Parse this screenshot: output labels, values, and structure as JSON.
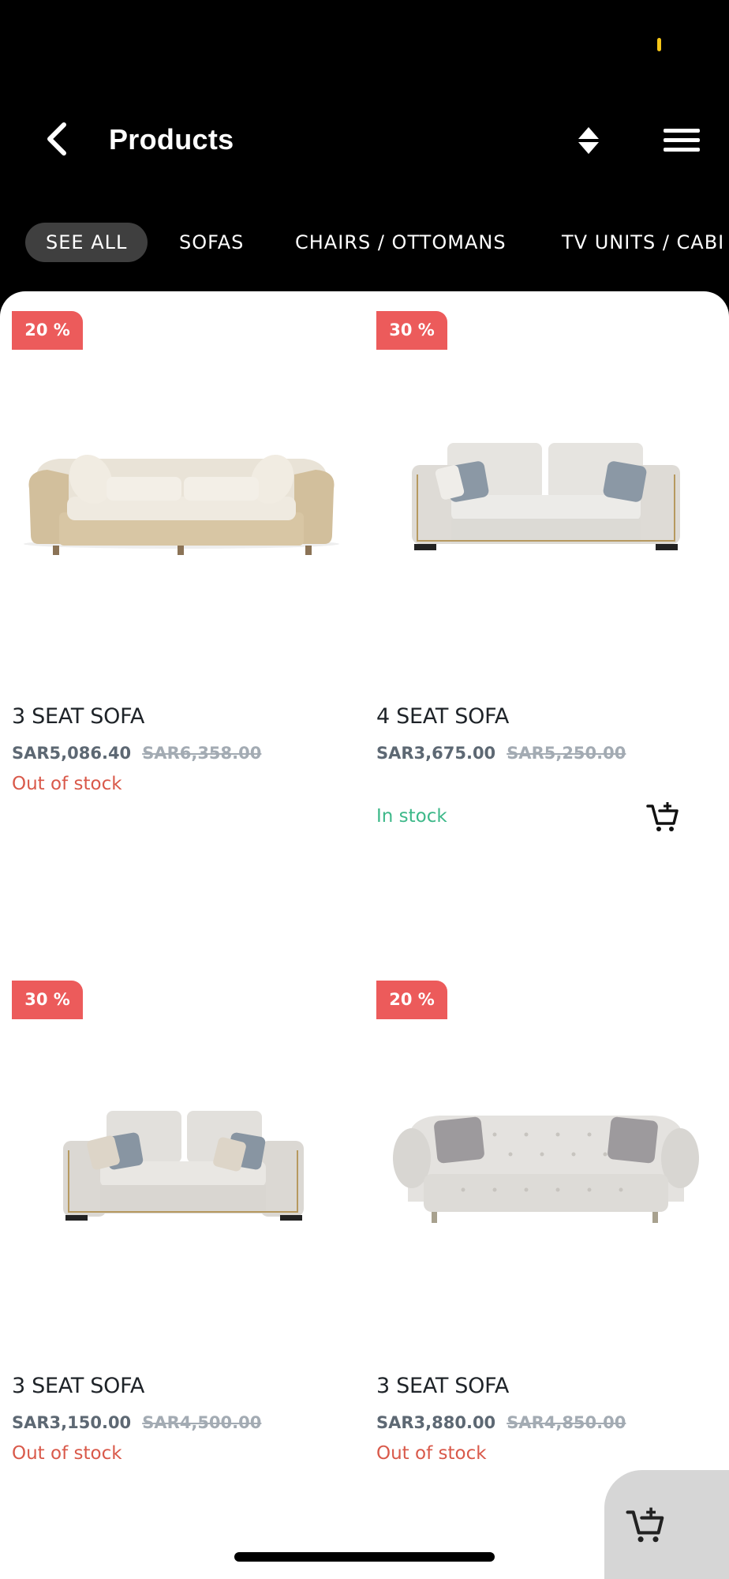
{
  "header": {
    "title": "Products",
    "back_icon": "chevron-left-icon",
    "sort_icon": "sort-icon",
    "menu_icon": "hamburger-menu-icon"
  },
  "tabs": [
    {
      "label": "SEE ALL",
      "active": true
    },
    {
      "label": "SOFAS",
      "active": false
    },
    {
      "label": "CHAIRS / OTTOMANS",
      "active": false
    },
    {
      "label": "TV UNITS / CABI",
      "active": false
    }
  ],
  "products": [
    {
      "discount": "20 %",
      "name": "3 SEAT SOFA",
      "price": "SAR5,086.40",
      "old_price": "SAR6,358.00",
      "stock": "Out of stock",
      "in_stock": false
    },
    {
      "discount": "30 %",
      "name": "4 SEAT SOFA",
      "price": "SAR3,675.00",
      "old_price": "SAR5,250.00",
      "stock": "In stock",
      "in_stock": true
    },
    {
      "discount": "30 %",
      "name": "3 SEAT SOFA",
      "price": "SAR3,150.00",
      "old_price": "SAR4,500.00",
      "stock": "Out of stock",
      "in_stock": false
    },
    {
      "discount": "20 %",
      "name": "3 SEAT SOFA",
      "price": "SAR3,880.00",
      "old_price": "SAR4,850.00",
      "stock": "Out of stock",
      "in_stock": false
    }
  ],
  "colors": {
    "badge": "#ec5b5b",
    "out_of_stock": "#d9594a",
    "in_stock": "#3db889",
    "status_indicator": "#f5c518"
  },
  "cart_icon": "add-to-cart-icon"
}
